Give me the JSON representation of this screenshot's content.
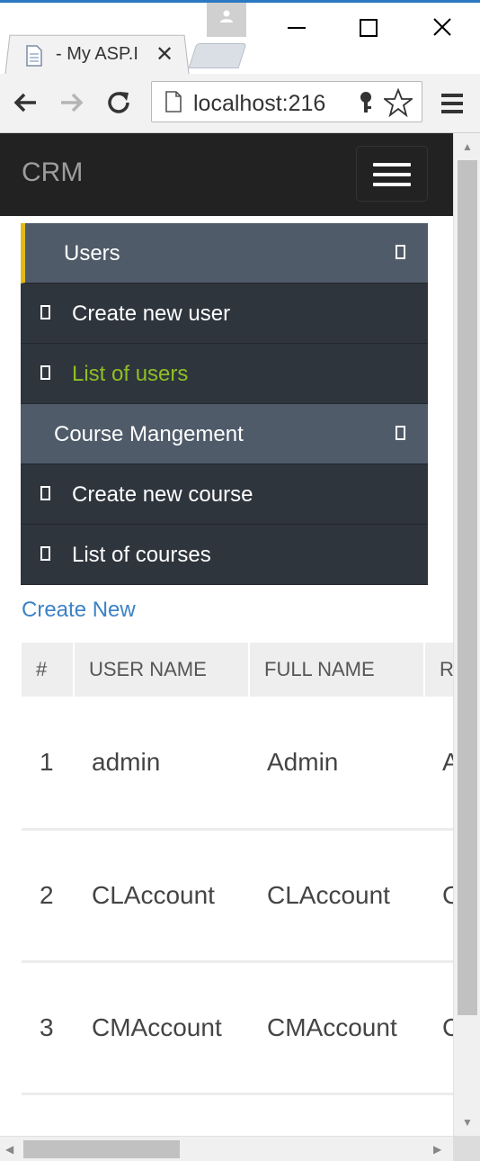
{
  "browser": {
    "tab_title": "- My ASP.I",
    "tab_close": "✕",
    "url": "localhost:216",
    "icons": [
      "profile-icon",
      "minimize-icon",
      "maximize-icon",
      "close-icon",
      "back-icon",
      "forward-icon",
      "reload-icon",
      "page-icon",
      "key-icon",
      "star-icon",
      "menu-icon"
    ]
  },
  "navbar": {
    "brand": "CRM"
  },
  "menu": {
    "users_group": "Users",
    "create_user": "Create new user",
    "list_users": "List of users",
    "course_group": "Course Mangement",
    "create_course": "Create new course",
    "list_courses": "List of courses"
  },
  "content": {
    "create_link": "Create New",
    "table": {
      "headers": [
        "#",
        "USER NAME",
        "FULL NAME",
        "R"
      ],
      "rows": [
        [
          "1",
          "admin",
          "Admin",
          "A"
        ],
        [
          "2",
          "CLAccount",
          "CLAccount",
          "C"
        ],
        [
          "3",
          "CMAccount",
          "CMAccount",
          "C"
        ]
      ]
    }
  },
  "colors": {
    "navbar": "#222222",
    "menu_group": "#4f5b69",
    "menu_item": "#2e353d",
    "active_marker": "#e0b91a",
    "highlight_text": "#8fbf24",
    "link": "#3c82c6"
  }
}
